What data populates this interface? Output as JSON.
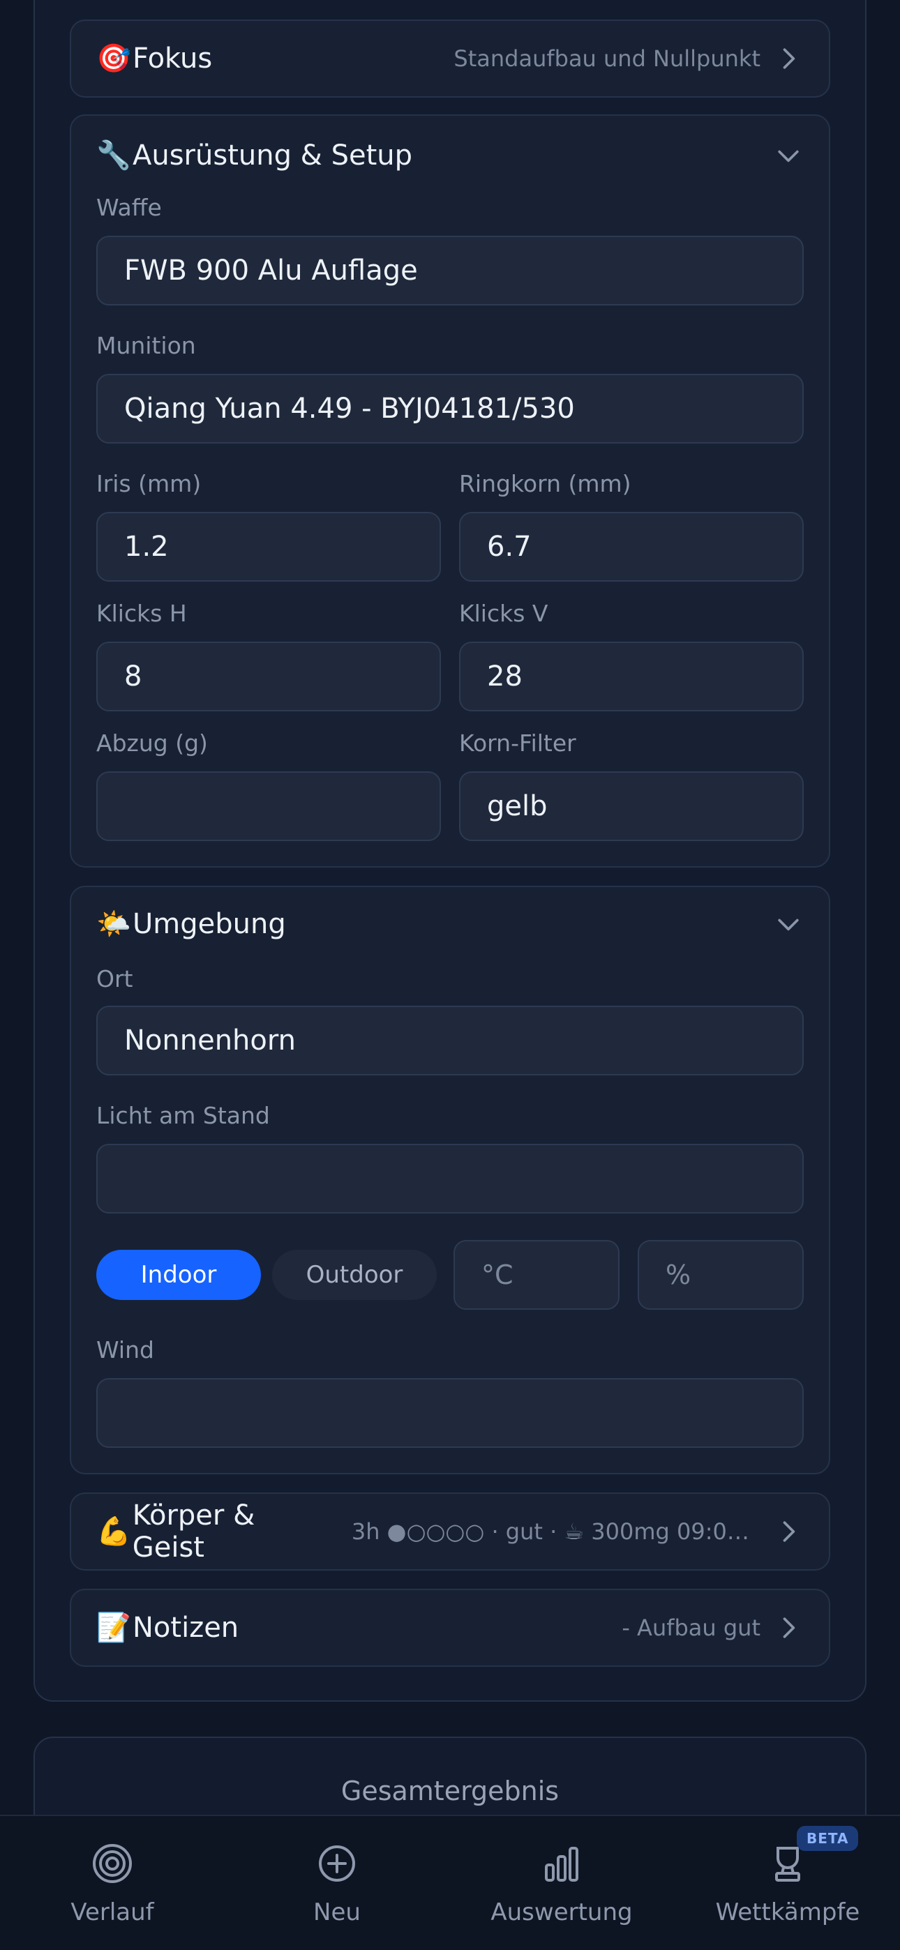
{
  "sections": {
    "fokus": {
      "icon": "🎯",
      "title": "Fokus",
      "subtitle": "Standaufbau und Nullpunkt"
    },
    "equipment": {
      "icon": "🔧",
      "title": "Ausrüstung & Setup",
      "waffe": {
        "label": "Waffe",
        "value": "FWB 900 Alu Auflage"
      },
      "munition": {
        "label": "Munition",
        "value": "Qiang Yuan 4.49 - BYJ04181/530"
      },
      "iris": {
        "label": "Iris (mm)",
        "value": "1.2"
      },
      "ringkorn": {
        "label": "Ringkorn (mm)",
        "value": "6.7"
      },
      "klicks_h": {
        "label": "Klicks H",
        "value": "8"
      },
      "klicks_v": {
        "label": "Klicks V",
        "value": "28"
      },
      "abzug": {
        "label": "Abzug (g)",
        "value": ""
      },
      "korn_filter": {
        "label": "Korn-Filter",
        "value": "gelb"
      }
    },
    "environment": {
      "icon": "🌤️",
      "title": "Umgebung",
      "ort": {
        "label": "Ort",
        "value": "Nonnenhorn"
      },
      "licht": {
        "label": "Licht am Stand",
        "value": ""
      },
      "toggle": {
        "indoor": "Indoor",
        "outdoor": "Outdoor",
        "selected": "Indoor"
      },
      "temperature_placeholder": "°C",
      "humidity_placeholder": "%",
      "wind": {
        "label": "Wind",
        "value": ""
      }
    },
    "body_mind": {
      "icon": "💪",
      "title": "Körper & Geist",
      "subtitle": "3h ●○○○○ · gut · ☕ 300mg 09:00..."
    },
    "notes": {
      "icon": "📝",
      "title": "Notizen",
      "subtitle": "- Aufbau gut"
    }
  },
  "result": {
    "label": "Gesamtergebnis"
  },
  "nav": {
    "items": [
      {
        "label": "Verlauf",
        "icon": "target-icon"
      },
      {
        "label": "Neu",
        "icon": "plus-circle-icon"
      },
      {
        "label": "Auswertung",
        "icon": "bar-chart-icon"
      },
      {
        "label": "Wettkämpfe",
        "icon": "trophy-icon"
      }
    ],
    "beta_badge": "BETA"
  },
  "colors": {
    "background": "#0f1727",
    "card": "#172133",
    "accent": "#1663ff",
    "text": "#eef2f8",
    "muted": "#8b96aa"
  }
}
